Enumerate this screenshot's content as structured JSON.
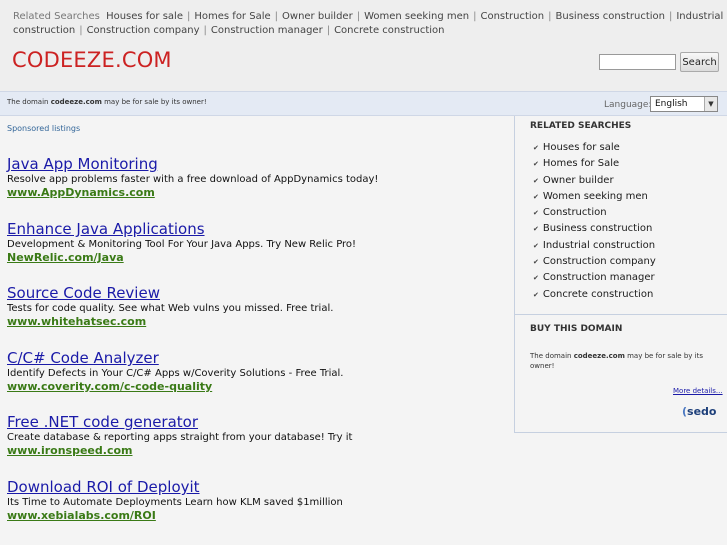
{
  "related_bar": {
    "title": "Related Searches",
    "items": [
      "Houses for sale",
      "Homes for Sale",
      "Owner builder",
      "Women seeking men",
      "Construction",
      "Business construction",
      "Industrial construction",
      "Construction company",
      "Construction manager",
      "Concrete construction"
    ]
  },
  "header": {
    "site_title": "CODEEZE.COM",
    "search_value": "",
    "search_button": "Search"
  },
  "notice": {
    "text_pre": "The domain ",
    "domain": "codeeze.com",
    "text_post": " may be for sale by its owner!",
    "language_label": "Language:",
    "language_value": "English"
  },
  "sponsored_label": "Sponsored listings",
  "ads": [
    {
      "title": "Java App Monitoring",
      "desc": "Resolve app problems faster with a free download of AppDynamics today!",
      "url": "www.AppDynamics.com"
    },
    {
      "title": "Enhance Java Applications",
      "desc": "Development & Monitoring Tool For Your Java Apps. Try New Relic Pro!",
      "url": "NewRelic.com/Java"
    },
    {
      "title": "Source Code Review",
      "desc": "Tests for code quality. See what Web vulns you missed. Free trial.",
      "url": "www.whitehatsec.com"
    },
    {
      "title": "C/C# Code Analyzer",
      "desc": "Identify Defects in Your C/C# Apps w/Coverity Solutions - Free Trial.",
      "url": "www.coverity.com/c-code-quality"
    },
    {
      "title": "Free .NET code generator",
      "desc": "Create database & reporting apps straight from your database! Try it",
      "url": "www.ironspeed.com"
    },
    {
      "title": "Download ROI of Deployit",
      "desc": "Its Time to Automate Deployments Learn how KLM saved $1million",
      "url": "www.xebialabs.com/ROI"
    }
  ],
  "sidebar": {
    "related_title": "RELATED SEARCHES",
    "related_items": [
      "Houses for sale",
      "Homes for Sale",
      "Owner builder",
      "Women seeking men",
      "Construction",
      "Business construction",
      "Industrial construction",
      "Construction company",
      "Construction manager",
      "Concrete construction"
    ],
    "buy_title": "BUY THIS DOMAIN",
    "buy_text_pre": "The domain ",
    "buy_domain": "codeeze.com",
    "buy_text_post": " may be for sale by its owner!",
    "more_details": "More details...",
    "sedo_logo": "sedo"
  },
  "icons": {
    "bullet": "bullet-icon",
    "dropdown": "chevron-down-icon"
  }
}
